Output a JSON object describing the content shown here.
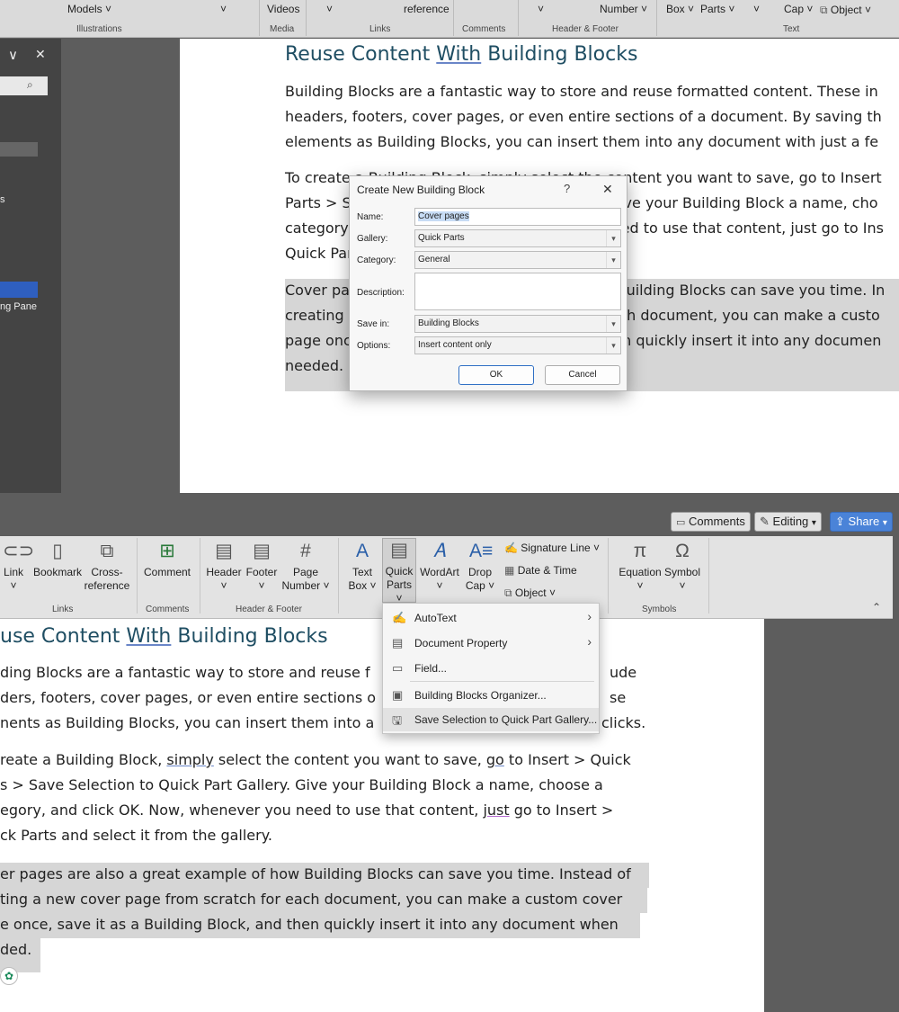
{
  "top_ribbon": {
    "items": [
      "Models",
      "Videos",
      "reference",
      "Number",
      "Box",
      "Parts",
      "Cap",
      "Object"
    ],
    "groups": [
      "Illustrations",
      "Media",
      "Links",
      "Comments",
      "Header & Footer",
      "Text"
    ],
    "chevron": "˅"
  },
  "left_pane": {
    "close_x": "✕",
    "chevron": "∨",
    "item_s": "s",
    "item_pane": "ng Pane",
    "search_glyph": "⌕"
  },
  "doc1": {
    "heading_pre": "Reuse Content ",
    "heading_with": "With",
    "heading_post": " Building Blocks",
    "p1": [
      "Building Blocks are a fantastic way to store and reuse formatted content. These in",
      "headers, footers, cover pages, or even entire sections of a document. By saving th",
      "elements as Building Blocks, you can insert them into any document with just a fe"
    ],
    "p2": [
      "To create a Building Block, simply select the content you want to save, go to Insert",
      "Parts > Save Selection to Quick Part Gallery. Give your Building Block a name, cho",
      "category, and click OK. Now, whenever you need to use that content, just go to Ins",
      "Quick Parts and select it from the gallery."
    ],
    "p3": [
      "Cover pages are also a great example of how Building Blocks can save you time. In",
      "creating a new cover page from scratch for each document, you can make a custo",
      "page once, save it as a Building Block, and then quickly insert it into any documen",
      "needed."
    ]
  },
  "dialog": {
    "title": "Create New Building Block",
    "help": "?",
    "close": "✕",
    "name_label": "Name:",
    "name_value": "Cover pages",
    "gallery_label": "Gallery:",
    "gallery_value": "Quick Parts",
    "category_label": "Category:",
    "category_value": "General",
    "description_label": "Description:",
    "description_value": "",
    "savein_label": "Save in:",
    "savein_value": "Building Blocks",
    "options_label": "Options:",
    "options_value": "Insert content only",
    "ok": "OK",
    "cancel": "Cancel"
  },
  "pills": {
    "comments": "Comments",
    "editing": "Editing",
    "share": "Share"
  },
  "ribbon2": {
    "link": "Link",
    "bookmark": "Bookmark",
    "cross_ref_1": "Cross-",
    "cross_ref_2": "reference",
    "comment": "Comment",
    "header": "Header",
    "footer": "Footer",
    "page_1": "Page",
    "page_2": "Number",
    "text_1": "Text",
    "text_2": "Box",
    "quick_1": "Quick",
    "quick_2": "Parts",
    "wordart": "WordArt",
    "drop_1": "Drop",
    "drop_2": "Cap",
    "signature": "Signature Line",
    "datetime": "Date & Time",
    "object": "Object",
    "equation": "Equation",
    "symbol": "Symbol",
    "groups": [
      "Links",
      "Comments",
      "Header & Footer",
      "Symbols"
    ],
    "collapse": "⌃",
    "chevron": "˅"
  },
  "doc2": {
    "heading_pre": "use Content ",
    "heading_with": "With",
    "heading_post": " Building Blocks",
    "p1": [
      "ding Blocks are a fantastic way to store and reuse f",
      "ders, footers, cover pages, or even entire sections o",
      "nents as Building Blocks, you can insert them into a"
    ],
    "p1_right": [
      "ude",
      "se",
      "clicks."
    ],
    "p2_a": "reate a Building Block, ",
    "p2_simply": "simply",
    "p2_b": " select the content you want to save, ",
    "p2_go": "go",
    "p2_c": " to Insert > Quick",
    "p2_l2": "s > Save Selection to Quick Part Gallery. Give your Building Block a name, choose a",
    "p2_l3a": "egory, and click OK. Now, whenever you need to use that content, ",
    "p2_just": "just",
    "p2_l3b": " go to Insert >",
    "p2_l4": "ck Parts and select it from the gallery.",
    "p3": [
      "er pages are also a great example of how Building Blocks can save you time. Instead of",
      "ting a new cover page from scratch for each document, you can make a custom cover",
      "e once, save it as a Building Block, and then quickly insert it into any document when",
      "ded."
    ]
  },
  "quick_parts_menu": {
    "autotext": "AutoText",
    "doc_property": "Document Property",
    "field": "Field...",
    "organizer": "Building Blocks Organizer...",
    "save_selection": "Save Selection to Quick Part Gallery...",
    "arrow": "›"
  },
  "colors": {
    "accent": "#1f4e63",
    "share": "#4a83d8",
    "highlight": "#d6d6d6"
  }
}
